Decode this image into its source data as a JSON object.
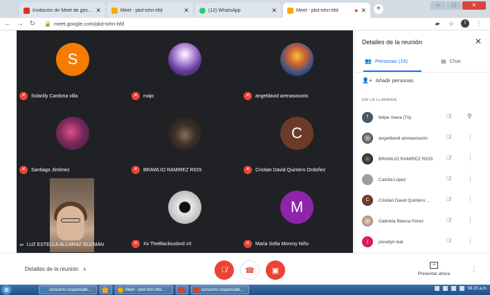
{
  "browser": {
    "tabs": [
      {
        "title": "Invitación de Meet de gestion so",
        "favicon": "gmail-icon",
        "color": "#d93025",
        "active": false
      },
      {
        "title": "Meet - pkd-txhn-bfd",
        "favicon": "meet-icon",
        "color": "#f9ab00",
        "active": false
      },
      {
        "title": "(12) WhatsApp",
        "favicon": "whatsapp-icon",
        "color": "#25d366",
        "active": false
      },
      {
        "title": "Meet - pkd-txhn-bfd",
        "favicon": "meet-icon",
        "color": "#f9ab00",
        "active": true
      }
    ],
    "new_tab": "+",
    "url": "meet.google.com/pkd-txhn-bfd",
    "profile_initial": "f"
  },
  "tiles": [
    {
      "name": "Solanlly Cardona villa",
      "initial": "S",
      "color": "#f57c00",
      "type": "letter"
    },
    {
      "name": "majo",
      "initial": "",
      "color": "#6a3fa0",
      "type": "image"
    },
    {
      "name": "angeldavid arenasosorio",
      "initial": "",
      "color": "#2c4c8c",
      "type": "image"
    },
    {
      "name": "Santiago Jiménez",
      "initial": "",
      "color": "#7c2a5a",
      "type": "image"
    },
    {
      "name": "BRAWLIO RAMIREZ RIOS",
      "initial": "",
      "color": "#2a2420",
      "type": "image"
    },
    {
      "name": "Cristian David Quintero Ordoñez",
      "initial": "C",
      "color": "#6d3a2a",
      "type": "letter"
    },
    {
      "name": "LUZ ESTELLA ALCARAZ GUZMÁN",
      "initial": "",
      "color": "#7b6554",
      "type": "video"
    },
    {
      "name": "Xx TheBlackiuslord xX",
      "initial": "",
      "color": "#cfcfcf",
      "type": "image"
    },
    {
      "name": "Maria Sofia Monroy Niño",
      "initial": "M",
      "color": "#8e24aa",
      "type": "letter"
    }
  ],
  "panel": {
    "title": "Detalles de la reunión",
    "tab_people": "Personas (19)",
    "tab_chat": "Chat",
    "add_people": "Añadir personas",
    "section_label": "EN LA LLAMADA",
    "people": [
      {
        "name": "felipe rivera (Tú)",
        "initial": "f",
        "color": "#455a64",
        "action": "pin"
      },
      {
        "name": "angeldavid arenasosorio",
        "initial": "",
        "color": "#2c4c8c",
        "action": "more"
      },
      {
        "name": "BRAWLIO RAMIREZ RIOS",
        "initial": "",
        "color": "#2a2420",
        "action": "more"
      },
      {
        "name": "Camila Lopez",
        "initial": "",
        "color": "#9e9e9e",
        "action": "more"
      },
      {
        "name": "Cristian David Quintero ...",
        "initial": "C",
        "color": "#6d3a2a",
        "action": "more"
      },
      {
        "name": "Gabriela Blanca Perez",
        "initial": "",
        "color": "#c9b5a3",
        "action": "more"
      },
      {
        "name": "josselyn leal",
        "initial": "j",
        "color": "#d81b60",
        "action": "more"
      }
    ]
  },
  "controls": {
    "details_label": "Detalles de la reunión",
    "present_label": "Presentar ahora"
  },
  "taskbar": {
    "tasks": [
      {
        "label": "consumo responsabl...",
        "color": "#3e7ac2"
      },
      {
        "label": "",
        "color": "#f0a030"
      },
      {
        "label": "Meet - pkd-txhn-bfd...",
        "color": "#f9ab00"
      },
      {
        "label": "",
        "color": "#e04030"
      },
      {
        "label": "consumo responsabl...",
        "color": "#d24726"
      }
    ],
    "clock": "08:25 a.m."
  }
}
